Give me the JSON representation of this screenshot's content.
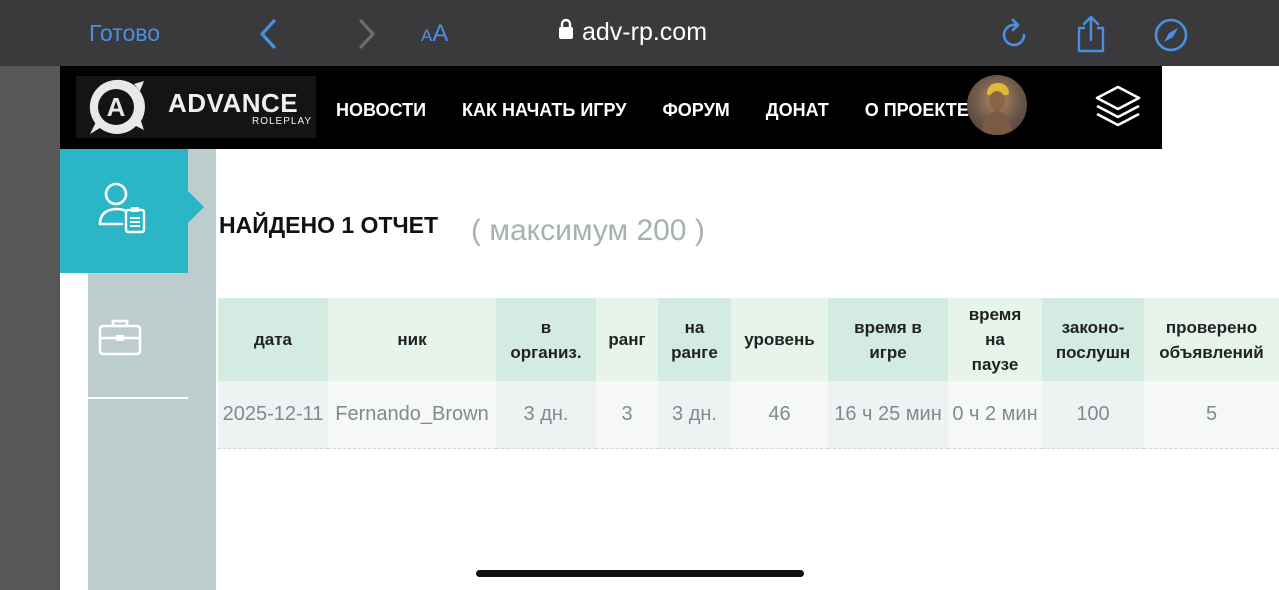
{
  "safari": {
    "done_label": "Готово",
    "text_size_small": "A",
    "text_size_large": "A",
    "url": "adv-rp.com"
  },
  "site": {
    "logo_letter": "A",
    "logo_text": "ADVANCE",
    "logo_sub": "ROLEPLAY",
    "nav": [
      "НОВОСТИ",
      "КАК НАЧАТЬ ИГРУ",
      "ФОРУМ",
      "ДОНАТ",
      "О ПРОЕКТЕ"
    ]
  },
  "sidebar": {
    "items": [
      {
        "icon": "report-user-icon",
        "active": true
      },
      {
        "icon": "briefcase-icon",
        "active": false
      }
    ],
    "active_color": "#2ab6c6"
  },
  "main": {
    "heading": "НАЙДЕНО 1 ОТЧЕТ",
    "subheading": "( максимум 200 )",
    "table": {
      "headers": [
        "дата",
        "ник",
        "в\nорганиз.",
        "ранг",
        "на\nранге",
        "уровень",
        "время в\nигре",
        "время\nна\nпаузе",
        "законо-\nпослушн",
        "проверено\nобъявлений"
      ],
      "rows": [
        [
          "2025-12-11",
          "Fernando_Brown",
          "3 дн.",
          "3",
          "3 дн.",
          "46",
          "16 ч 25 мин",
          "0 ч 2 мин",
          "100",
          "5"
        ]
      ]
    }
  }
}
